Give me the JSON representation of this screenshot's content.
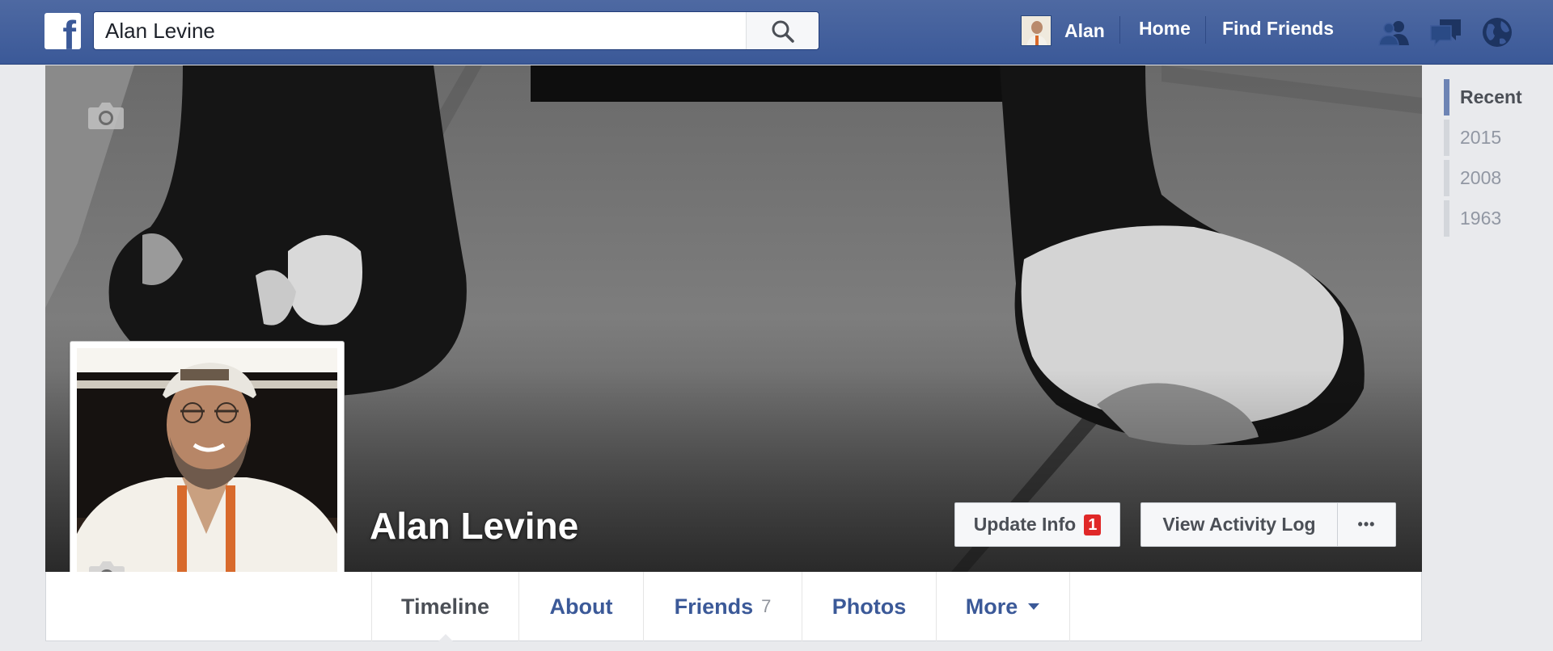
{
  "topbar": {
    "logo": "f",
    "search": {
      "value": "Alan Levine"
    },
    "user_name": "Alan",
    "home": "Home",
    "find_friends": "Find Friends",
    "icons": [
      "search-icon",
      "friend-requests-icon",
      "messages-icon",
      "notifications-globe-icon"
    ]
  },
  "profile": {
    "name": "Alan Levine",
    "actions": {
      "update_info": "Update Info",
      "update_badge": "1",
      "view_activity_log": "View Activity Log",
      "more_dots": "•••"
    }
  },
  "tabs": {
    "timeline": "Timeline",
    "about": "About",
    "friends": "Friends",
    "friends_count": "7",
    "photos": "Photos",
    "more": "More"
  },
  "years": [
    "Recent",
    "2015",
    "2008",
    "1963"
  ],
  "colors": {
    "brand_blue": "#3b5998",
    "badge_red": "#e02828",
    "page_bg": "#e9eaed"
  }
}
